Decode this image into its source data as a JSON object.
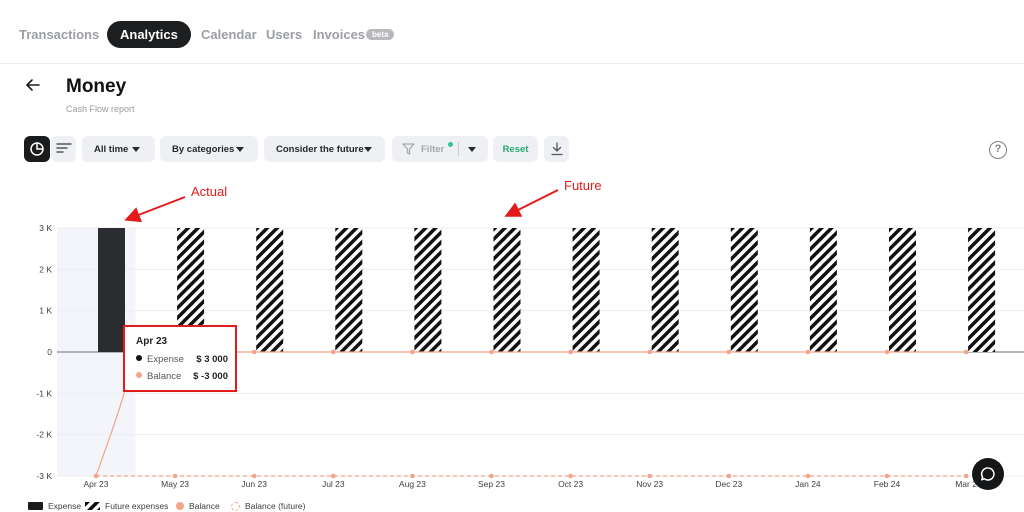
{
  "nav": {
    "tabs": [
      {
        "label": "Transactions"
      },
      {
        "label": "Analytics"
      },
      {
        "label": "Calendar"
      },
      {
        "label": "Users"
      },
      {
        "label": "Invoices"
      }
    ],
    "beta_label": "beta"
  },
  "page": {
    "title": "Money",
    "subtitle": "Cash Flow report"
  },
  "toolbar": {
    "period": "All time",
    "grouping": "By categories",
    "future": "Consider the future",
    "filter": "Filter",
    "reset": "Reset",
    "help": "?"
  },
  "colors": {
    "expense": "#2b2c2f",
    "balance": "#f4a489",
    "reset": "#2aa876",
    "annotation": "#e21b1b",
    "filter_dot": "#2ec4a0",
    "actual_band": "#f4f5fb"
  },
  "icons": {
    "back": "arrow-left-icon",
    "chart_view": "pie-chart-icon",
    "list_view": "sort-lines-icon",
    "filter": "funnel-icon",
    "download": "download-icon",
    "chat": "chat-bubble-icon"
  },
  "annotations": {
    "actual": "Actual",
    "future": "Future"
  },
  "tooltip": {
    "date": "Apr 23",
    "rows": [
      {
        "label": "Expense",
        "value": "$ 3 000"
      },
      {
        "label": "Balance",
        "value": "$ -3 000"
      }
    ]
  },
  "chart_data": {
    "type": "bar",
    "categories": [
      "Apr 23",
      "May 23",
      "Jun 23",
      "Jul 23",
      "Aug 23",
      "Sep 23",
      "Oct 23",
      "Nov 23",
      "Dec 23",
      "Jan 24",
      "Feb 24",
      "Mar 24"
    ],
    "x_tick_labels": [
      "Apr 23",
      "May 23",
      "Jun 23",
      "Jul 23",
      "Aug 23",
      "Sep 23",
      "Oct 23",
      "Nov 23",
      "Dec 23",
      "Jan 24",
      "Feb 24",
      "Mar 2"
    ],
    "series": [
      {
        "name": "Expense",
        "kind": "bar",
        "values": [
          3000,
          null,
          null,
          null,
          null,
          null,
          null,
          null,
          null,
          null,
          null,
          null
        ]
      },
      {
        "name": "Future expenses",
        "kind": "bar-hatched",
        "values": [
          null,
          3000,
          3000,
          3000,
          3000,
          3000,
          3000,
          3000,
          3000,
          3000,
          3000,
          3000
        ]
      },
      {
        "name": "Balance",
        "kind": "line",
        "values": [
          -3000,
          0,
          0,
          0,
          0,
          0,
          0,
          0,
          0,
          0,
          0,
          0
        ]
      },
      {
        "name": "Balance (future)",
        "kind": "line-dashed",
        "values": [
          -3000,
          -3000,
          -3000,
          -3000,
          -3000,
          -3000,
          -3000,
          -3000,
          -3000,
          -3000,
          -3000,
          -3000
        ]
      }
    ],
    "y_ticks": [
      3000,
      2000,
      1000,
      0,
      -1000,
      -2000,
      -3000
    ],
    "y_tick_labels": [
      "3 K",
      "2 K",
      "1 K",
      "0",
      "-1 K",
      "-2 K",
      "-3 K"
    ],
    "ylim": [
      -3000,
      3000
    ],
    "grid": true,
    "legend_position": "bottom-left",
    "highlighted_category": "Apr 23"
  }
}
